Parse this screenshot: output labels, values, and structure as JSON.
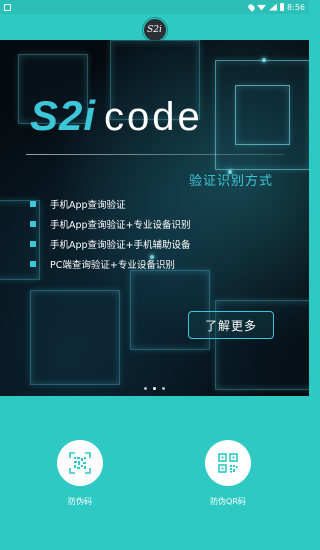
{
  "status_bar": {
    "time": "8:56",
    "icons": [
      "notification-icon",
      "location-icon",
      "wifi-icon",
      "signal-icon",
      "battery-icon"
    ]
  },
  "header": {
    "logo_text": "S2i"
  },
  "banner": {
    "brand_part1": "S2i",
    "brand_part2": "code",
    "subtitle": "验证识别方式",
    "features": [
      "手机App查询验证",
      "手机App查询验证+专业设备识别",
      "手机App查询验证+手机辅助设备",
      "PC端查询验证+专业设备识别"
    ],
    "more_button": "了解更多",
    "pager": {
      "count": 3,
      "active_index": 1
    }
  },
  "actions": [
    {
      "label": "防伪码",
      "icon": "scan-icon"
    },
    {
      "label": "防伪QR码",
      "icon": "qr-code-icon"
    }
  ],
  "colors": {
    "accent": "#2ec9c2",
    "brand_cyan": "#3cc7d8",
    "banner_bg": "#050a0f"
  }
}
